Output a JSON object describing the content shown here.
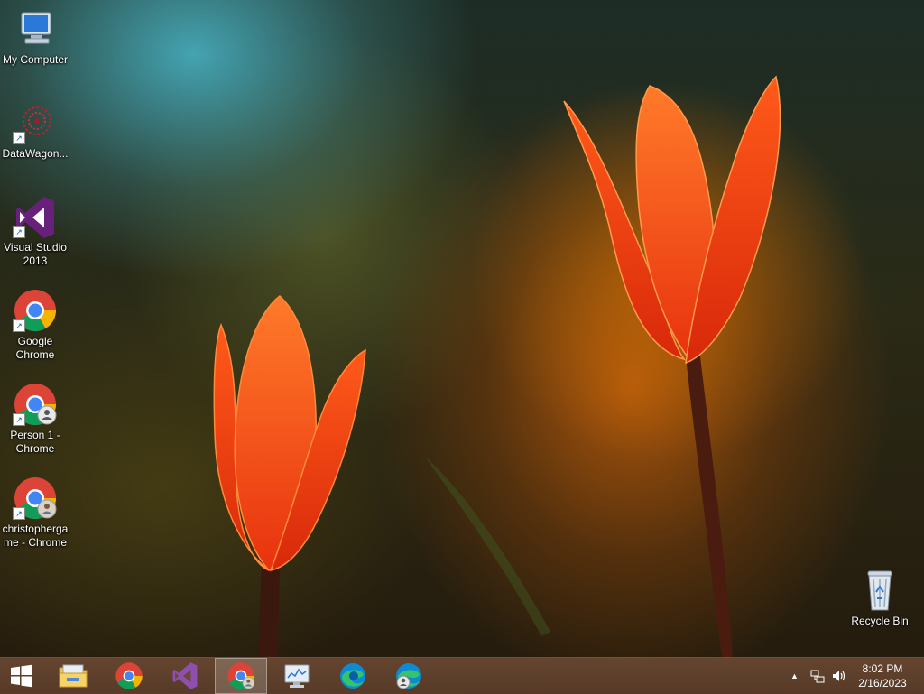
{
  "desktop": {
    "icons": [
      {
        "label": "My Computer",
        "icon": "computer-icon"
      },
      {
        "label": "DataWagon...",
        "icon": "datawagon-icon"
      },
      {
        "label": "Visual Studio 2013",
        "icon": "visual-studio-icon"
      },
      {
        "label": "Google Chrome",
        "icon": "chrome-icon"
      },
      {
        "label": "Person 1 - Chrome",
        "icon": "chrome-person-icon"
      },
      {
        "label": "christopherga me - Chrome",
        "icon": "chrome-profile-icon"
      }
    ],
    "recycle_bin": {
      "label": "Recycle Bin",
      "icon": "recycle-bin-icon"
    }
  },
  "taskbar": {
    "buttons": [
      {
        "name": "start",
        "icon": "windows-logo-icon"
      },
      {
        "name": "file-explorer",
        "icon": "folder-icon"
      },
      {
        "name": "chrome",
        "icon": "chrome-icon"
      },
      {
        "name": "visual-studio",
        "icon": "visual-studio-icon"
      },
      {
        "name": "chrome-profile",
        "icon": "chrome-profile-icon",
        "active": true
      },
      {
        "name": "task-manager",
        "icon": "monitor-chart-icon"
      },
      {
        "name": "edge",
        "icon": "edge-icon"
      },
      {
        "name": "edge-profile",
        "icon": "edge-profile-icon"
      }
    ],
    "tray": {
      "overflow": "▲",
      "time": "8:02 PM",
      "date": "2/16/2023"
    }
  },
  "colors": {
    "taskbar": "#6b4a34",
    "tulip": "#ff4a12",
    "vs_purple": "#68217a",
    "chrome_red": "#db4437",
    "chrome_yellow": "#f4b400",
    "chrome_green": "#0f9d58",
    "chrome_blue": "#4285f4"
  }
}
